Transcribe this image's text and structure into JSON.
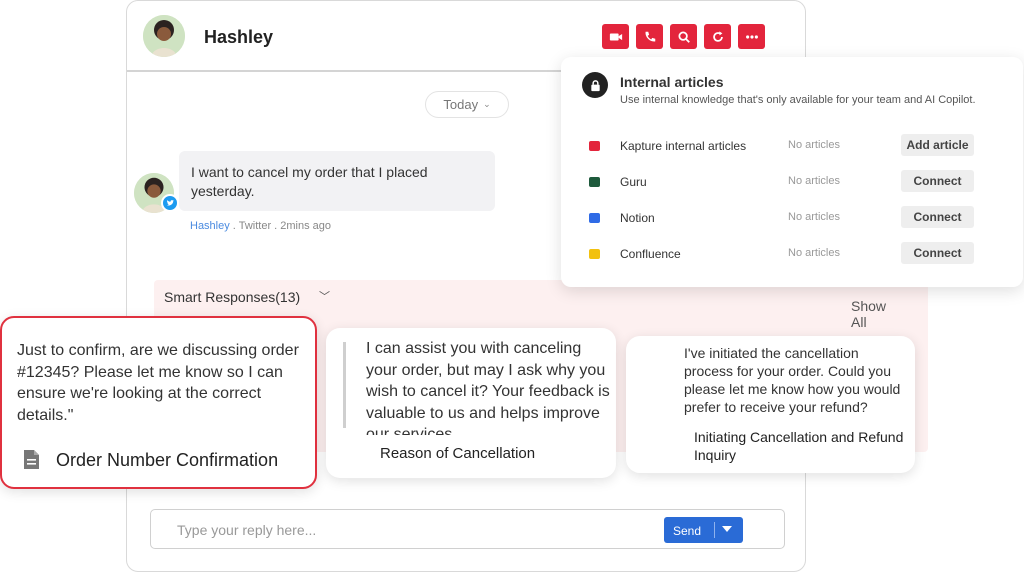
{
  "header": {
    "contact_name": "Hashley",
    "actions": [
      "video-icon",
      "phone-icon",
      "search-icon",
      "refresh-icon",
      "more-icon"
    ],
    "accent_color": "#e3253c"
  },
  "chat": {
    "date_filter": "Today",
    "message": {
      "text": "I want to cancel my order that I placed yesterday.",
      "author": "Hashley",
      "meta": " . Twitter . 2mins ago"
    }
  },
  "smart_responses": {
    "title": "Smart Responses(13)",
    "show_all": "Show All",
    "cards": [
      {
        "text": "Just to confirm, are we discussing order #12345? Please let me know so I can ensure we're looking at the correct details.\"",
        "label": "Order Number Confirmation",
        "selected": true
      },
      {
        "text": "I can assist you with canceling your order, but may I ask why you wish to cancel it? Your feedback is valuable to us and helps improve our services.",
        "label": "Reason of Cancellation",
        "selected": false
      },
      {
        "text": "I've initiated the cancellation process for your order. Could you please let me know how you would prefer to receive your refund?",
        "label": "Initiating Cancellation and Refund Inquiry",
        "selected": false
      }
    ]
  },
  "internal_articles": {
    "title": "Internal articles",
    "subtitle": "Use internal knowledge that's only available for your team and AI Copilot.",
    "sources": [
      {
        "name": "Kapture internal articles",
        "status": "No articles",
        "action": "Add article",
        "color": "#e3253c"
      },
      {
        "name": "Guru",
        "status": "No articles",
        "action": "Connect",
        "color": "#1e5a3c"
      },
      {
        "name": "Notion",
        "status": "No articles",
        "action": "Connect",
        "color": "#2f6be6"
      },
      {
        "name": "Confluence",
        "status": "No articles",
        "action": "Connect",
        "color": "#f2c10f"
      }
    ]
  },
  "reply": {
    "placeholder": "Type your reply here...",
    "send_label": "Send"
  }
}
